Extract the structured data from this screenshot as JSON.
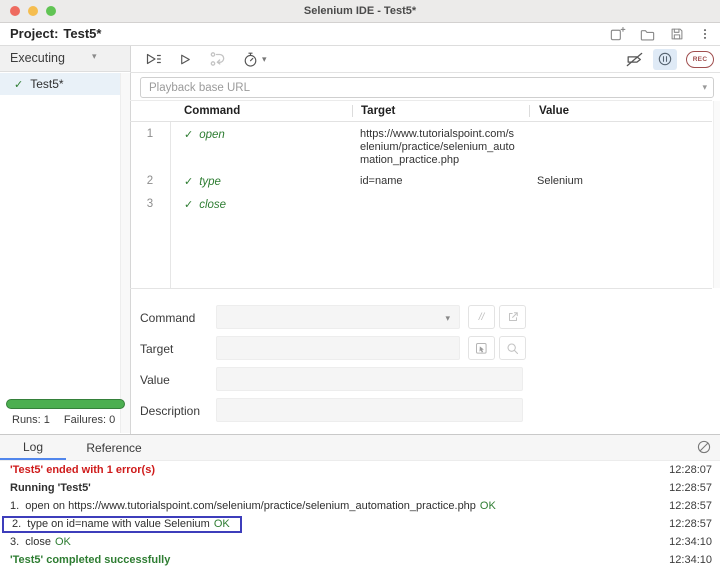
{
  "titlebar": {
    "title": "Selenium IDE - Test5*"
  },
  "project_bar": {
    "label": "Project:",
    "name": "Test5*"
  },
  "toolbar": {
    "rec_label": "REC",
    "comment_glyph": "//"
  },
  "playback": {
    "placeholder": "Playback base URL"
  },
  "sidebar": {
    "header": "Executing",
    "check": "✓",
    "test_name": "Test5*",
    "runs": "Runs: 1",
    "failures": "Failures: 0"
  },
  "table": {
    "headers": {
      "command": "Command",
      "target": "Target",
      "value": "Value"
    },
    "rows": [
      {
        "num": "1",
        "check": "✓",
        "command": "open",
        "target": "https://www.tutorialspoint.com/selenium/practice/selenium_automation_practice.php",
        "value": ""
      },
      {
        "num": "2",
        "check": "✓",
        "command": "type",
        "target": "id=name",
        "value": "Selenium"
      },
      {
        "num": "3",
        "check": "✓",
        "command": "close",
        "target": "",
        "value": ""
      }
    ]
  },
  "form": {
    "command_label": "Command",
    "target_label": "Target",
    "value_label": "Value",
    "description_label": "Description"
  },
  "log": {
    "tabs": {
      "log": "Log",
      "reference": "Reference"
    },
    "entries": [
      {
        "text": "'Test5' ended with 1 error(s)",
        "ok": "",
        "time": "12:28:07"
      },
      {
        "text": "Running 'Test5'",
        "ok": "",
        "time": "12:28:57"
      },
      {
        "text": "1.  open on https://www.tutorialspoint.com/selenium/practice/selenium_automation_practice.php",
        "ok": "OK",
        "time": "12:28:57"
      },
      {
        "text": "2.  type on id=name with value Selenium",
        "ok": "OK",
        "time": "12:28:57"
      },
      {
        "text": "3.  close",
        "ok": "OK",
        "time": "12:34:10"
      },
      {
        "text": "'Test5' completed successfully",
        "ok": "",
        "time": "12:34:10"
      }
    ]
  },
  "icons": {
    "new-project-icon": "document-with-plus",
    "open-project-icon": "folder",
    "save-project-icon": "floppy-disk",
    "menu-icon": "kebab-dots",
    "run-all-icon": "play-with-list",
    "run-current-icon": "play",
    "step-over-icon": "step-over-arrow",
    "speed-icon": "stopwatch",
    "disable-breakpoints-icon": "crossed-flag",
    "pause-on-exceptions-icon": "pause-in-circle",
    "record-button": "REC-pill",
    "comment-toggle-icon": "double-slash",
    "open-editor-icon": "external-window",
    "select-target-icon": "cursor-in-box",
    "find-target-icon": "magnifier",
    "clear-log-icon": "circle-slash",
    "dropdown-caret": "▾"
  },
  "colors": {
    "titlebar_bg": "#ecebea",
    "command_green": "#2e7d32",
    "error_red": "#cf1b1b",
    "success_green": "#2e7d32",
    "tab_accent_blue": "#5186ec",
    "selected_test_blue": "#e9f1f8",
    "log_box_border": "#3d3dbb",
    "rec_maroon": "#a04f4f",
    "progress_green": "#4caf50",
    "pause_highlight": "#dfeaf6"
  }
}
